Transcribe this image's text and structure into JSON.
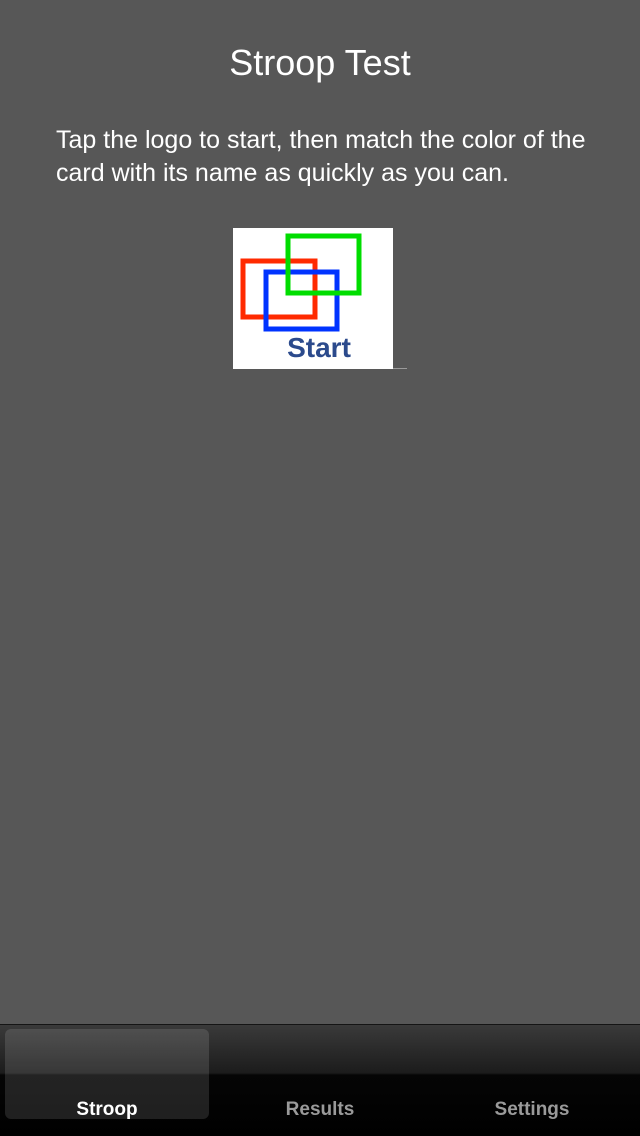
{
  "screen": {
    "title": "Stroop Test",
    "instructions": "Tap the logo to start, then match the color of the card with its name as quickly as you can.",
    "logo": {
      "label": "Start",
      "square_colors": [
        "#ff2a00",
        "#0033ff",
        "#00dd00"
      ],
      "label_color": "#2b4a8c"
    }
  },
  "tabbar": {
    "tabs": [
      {
        "label": "Stroop",
        "selected": true
      },
      {
        "label": "Results",
        "selected": false
      },
      {
        "label": "Settings",
        "selected": false
      }
    ]
  }
}
